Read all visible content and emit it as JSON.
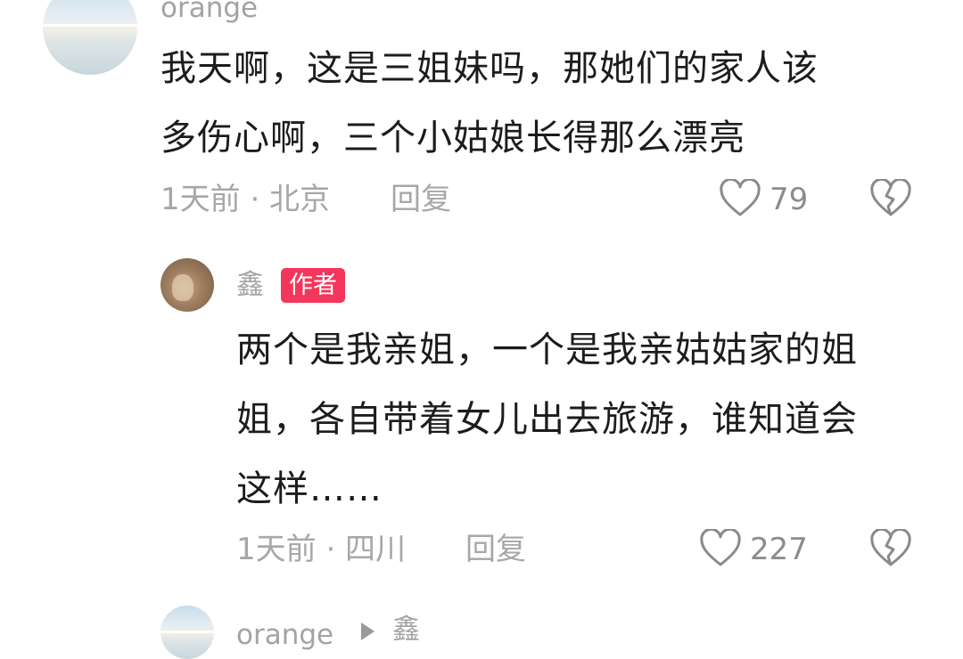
{
  "comments": [
    {
      "username": "orange",
      "text_lines": [
        "我天啊，这是三姐妹吗，那她们的家人该",
        "多伤心啊，三个小姑娘长得那么漂亮"
      ],
      "meta": "1天前 · 北京",
      "reply_label": "回复",
      "like_count": "79"
    }
  ],
  "reply": {
    "username": "鑫",
    "badge": "作者",
    "text_lines": [
      "两个是我亲姐，一个是我亲姑姑家的姐",
      "姐，各自带着女儿出去旅游，谁知道会",
      "这样……"
    ],
    "meta": "1天前 · 四川",
    "reply_label": "回复",
    "like_count": "227"
  },
  "next_reply": {
    "username": "orange",
    "target": "鑫"
  },
  "icons": {
    "like": "heart-outline-icon",
    "dislike": "broken-heart-icon",
    "reply_arrow": "play-arrow-icon"
  },
  "colors": {
    "badge": "#f5365c",
    "text": "#1c1c1c",
    "muted": "#a7a7a7"
  }
}
